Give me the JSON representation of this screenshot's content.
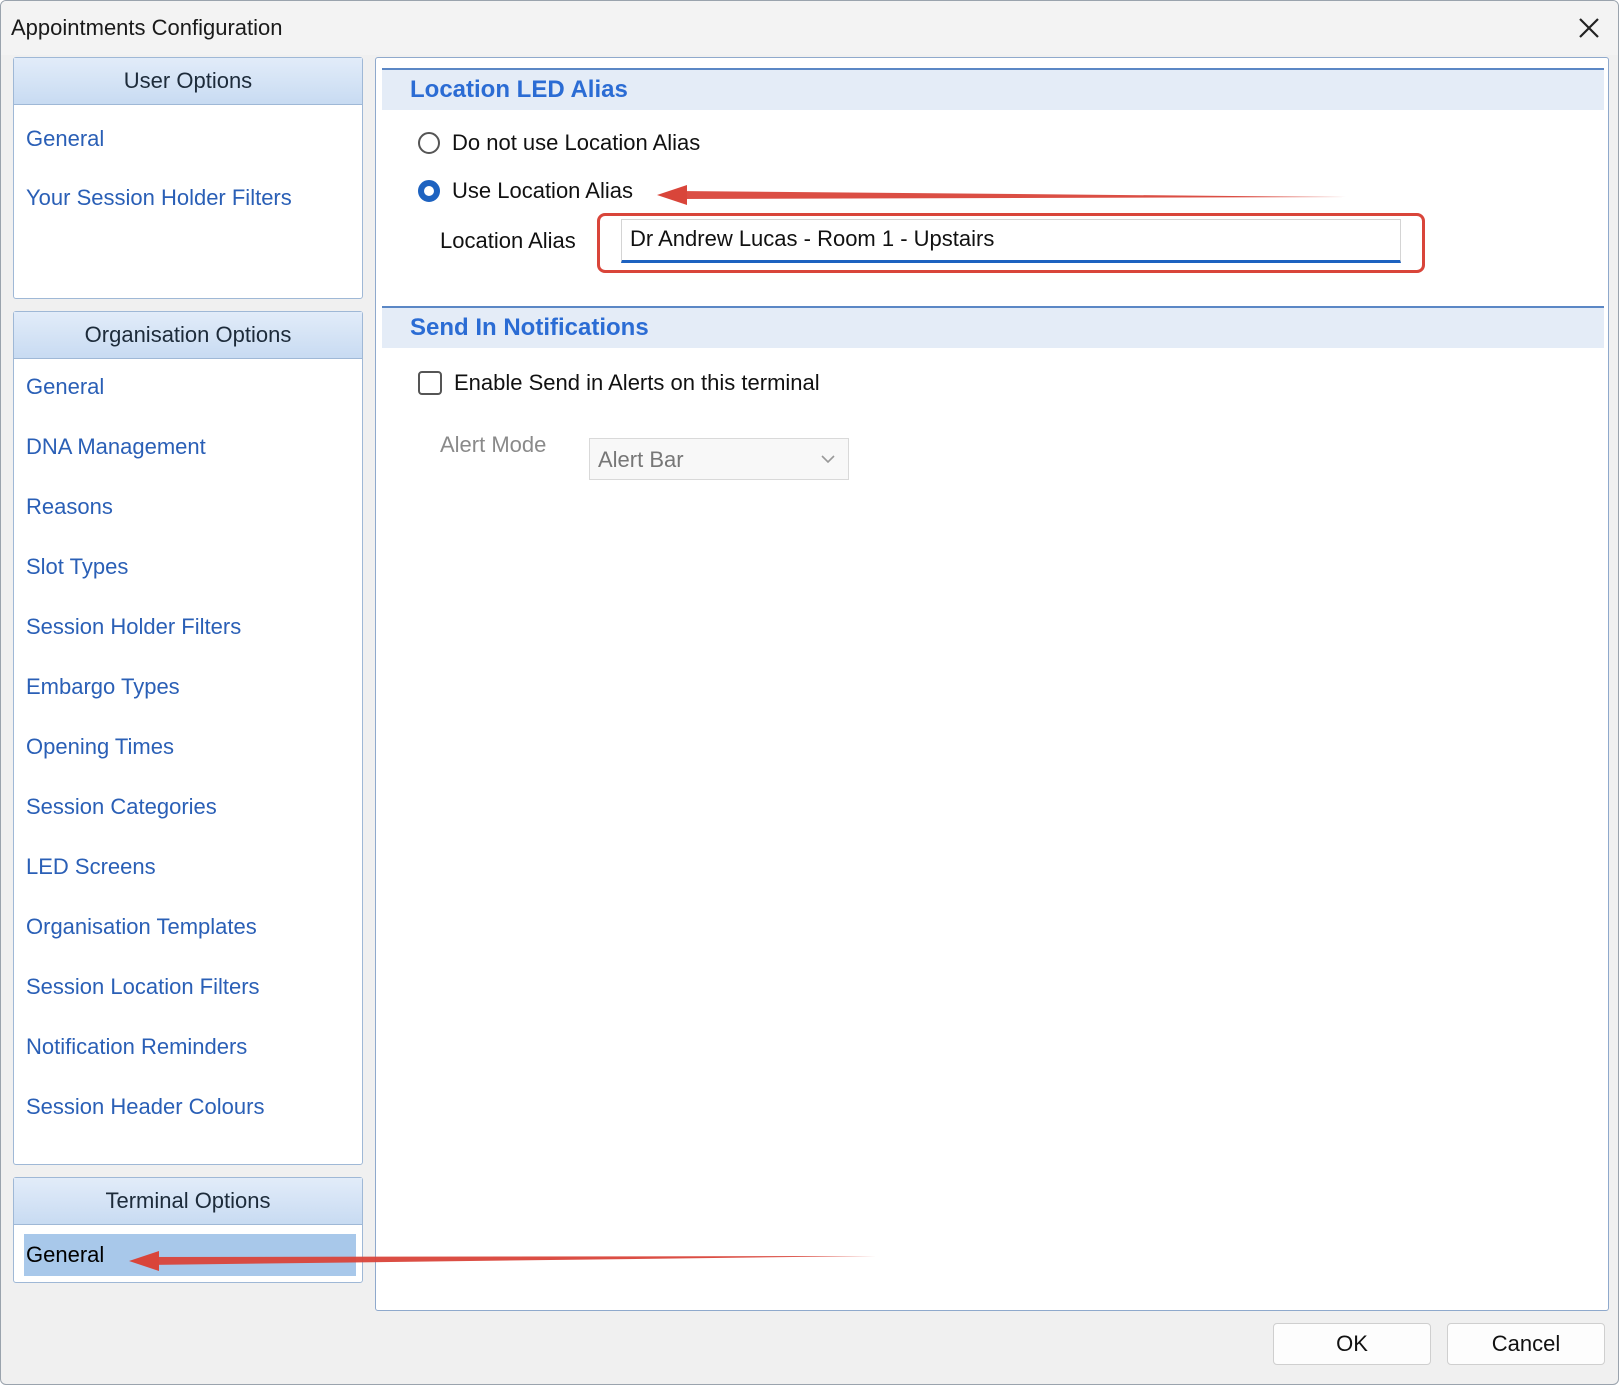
{
  "window": {
    "title": "Appointments Configuration"
  },
  "sidebar": {
    "user_options": {
      "header": "User Options",
      "items": [
        "General",
        "Your Session Holder Filters"
      ]
    },
    "organisation_options": {
      "header": "Organisation Options",
      "items": [
        "General",
        "DNA Management",
        "Reasons",
        "Slot Types",
        "Session Holder Filters",
        "Embargo Types",
        "Opening Times",
        "Session Categories",
        "LED Screens",
        "Organisation Templates",
        "Session Location Filters",
        "Notification Reminders",
        "Session Header Colours"
      ]
    },
    "terminal_options": {
      "header": "Terminal Options",
      "items": [
        "General"
      ],
      "selected": "General"
    }
  },
  "location_led_alias": {
    "title": "Location LED Alias",
    "option_none": "Do not use Location Alias",
    "option_use": "Use Location Alias",
    "selected_option": "Use Location Alias",
    "alias_label": "Location Alias",
    "alias_value": "Dr Andrew Lucas - Room 1 - Upstairs"
  },
  "send_in_notifications": {
    "title": "Send In Notifications",
    "enable_label": "Enable Send in Alerts on this terminal",
    "enabled": false,
    "alert_mode_label": "Alert Mode",
    "alert_mode_value": "Alert Bar"
  },
  "footer": {
    "ok_label": "OK",
    "cancel_label": "Cancel"
  },
  "colors": {
    "accent": "#2b6cd4",
    "link": "#2a5fb6",
    "annotation": "#d9453a",
    "selection": "#a8c8ea"
  }
}
